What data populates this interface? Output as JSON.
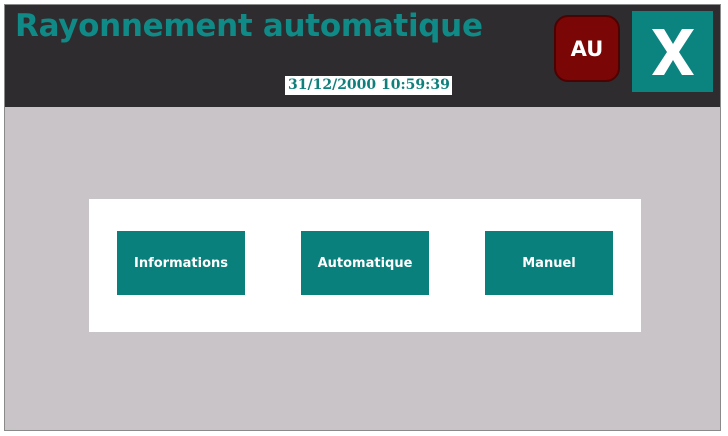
{
  "header": {
    "title": "Rayonnement automatique",
    "datetime": "31/12/2000 10:59:39",
    "au_label": "AU",
    "close_icon": "close-x-icon"
  },
  "menu": {
    "buttons": [
      {
        "label": "Informations"
      },
      {
        "label": "Automatique"
      },
      {
        "label": "Manuel"
      }
    ]
  },
  "colors": {
    "header_bg": "#2e2c2e",
    "accent_teal": "#0a807c",
    "title_teal": "#0f8a87",
    "au_red": "#7a0605",
    "screen_bg": "#c8c4c7"
  }
}
